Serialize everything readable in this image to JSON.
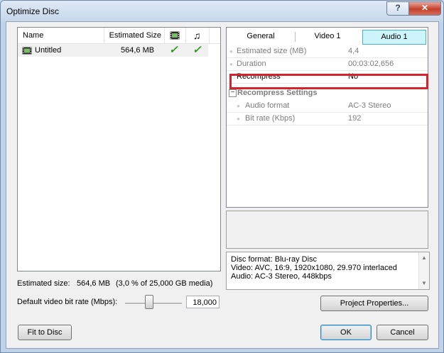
{
  "window": {
    "title": "Optimize Disc",
    "help_label": "?",
    "close_label": "✕"
  },
  "list": {
    "columns": {
      "name": "Name",
      "size": "Estimated Size",
      "video_icon": "film-icon",
      "audio_icon": "music-note-icon"
    },
    "rows": [
      {
        "name": "Untitled",
        "size": "564,6 MB",
        "video": "✓",
        "audio": "✓"
      }
    ]
  },
  "tabs": [
    "General",
    "Video 1",
    "Audio 1"
  ],
  "properties": [
    {
      "key": "Estimated size (MB)",
      "value": "4,4"
    },
    {
      "key": "Duration",
      "value": "00:03:02,656"
    },
    {
      "key": "Recompress",
      "value": "No"
    }
  ],
  "group": {
    "label": "Recompress Settings",
    "toggle": "−"
  },
  "group_properties": [
    {
      "key": "Audio format",
      "value": "AC-3 Stereo"
    },
    {
      "key": "Bit rate (Kbps)",
      "value": "192"
    }
  ],
  "info": {
    "line1": "Disc format:  Blu-ray Disc",
    "line2": "Video:  AVC, 16:9, 1920x1080, 29.970 interlaced",
    "line3": "Audio:  AC-3 Stereo, 448kbps"
  },
  "estimated": {
    "label": "Estimated size:",
    "value": "564,6 MB",
    "detail": "(3,0 % of 25,000 GB media)"
  },
  "bitrate": {
    "label": "Default video bit rate (Mbps):",
    "value": "18,000"
  },
  "buttons": {
    "project_properties": "Project Properties...",
    "fit_to_disc": "Fit to Disc",
    "ok": "OK",
    "cancel": "Cancel"
  },
  "colors": {
    "highlight": "#d2232e",
    "active_tab": "#cdf4fb",
    "check": "#2f9a26"
  }
}
